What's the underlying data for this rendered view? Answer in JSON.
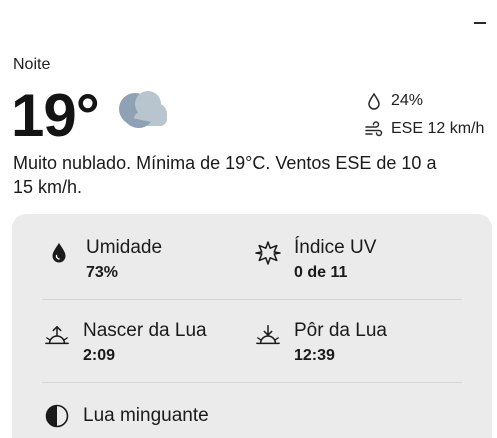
{
  "window": {
    "minimize_label": "Minimize"
  },
  "current": {
    "period": "Noite",
    "temperature": "19°",
    "condition_icon": "cloudy-night-icon",
    "precipitation": "24%",
    "wind": "ESE 12 km/h",
    "summary": "Muito nublado. Mínima de 19°C. Ventos ESE de 10 a 15 km/h."
  },
  "details": {
    "humidity": {
      "label": "Umidade",
      "value": "73%",
      "icon": "droplet-icon"
    },
    "uv": {
      "label": "Índice UV",
      "value": "0 de 11",
      "icon": "sun-outline-icon"
    },
    "moonrise": {
      "label": "Nascer da Lua",
      "value": "2:09",
      "icon": "moonrise-icon"
    },
    "moonset": {
      "label": "Pôr da Lua",
      "value": "12:39",
      "icon": "moonset-icon"
    },
    "moon_phase": {
      "label": "Lua minguante",
      "icon": "moon-phase-icon"
    }
  },
  "colors": {
    "card_background": "#ebebeb",
    "cloud": "#b0bcc6",
    "moon": "#8fa2b3"
  }
}
